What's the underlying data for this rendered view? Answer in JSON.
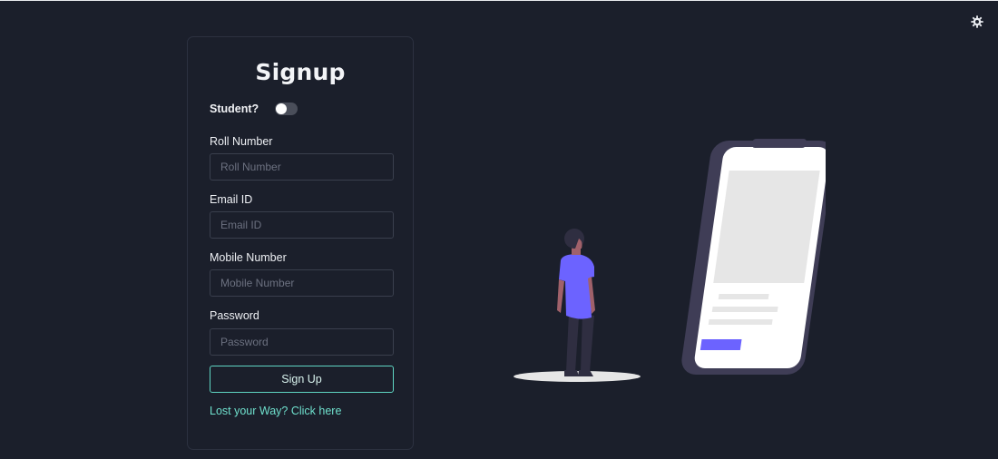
{
  "app": {
    "theme_icon": "gear-icon"
  },
  "form": {
    "title": "Signup",
    "student_toggle": {
      "label": "Student?",
      "checked": false
    },
    "fields": [
      {
        "label": "Roll Number",
        "placeholder": "Roll Number",
        "value": ""
      },
      {
        "label": "Email ID",
        "placeholder": "Email ID",
        "value": ""
      },
      {
        "label": "Mobile Number",
        "placeholder": "Mobile Number",
        "value": ""
      },
      {
        "label": "Password",
        "placeholder": "Password",
        "value": ""
      }
    ],
    "submit_label": "Sign Up",
    "lost_link": "Lost your Way? Click here"
  },
  "colors": {
    "background": "#1b1f2b",
    "accent": "#6fe0cd",
    "illustration_accent": "#6c63ff",
    "phone_frame": "#3f3d56"
  }
}
